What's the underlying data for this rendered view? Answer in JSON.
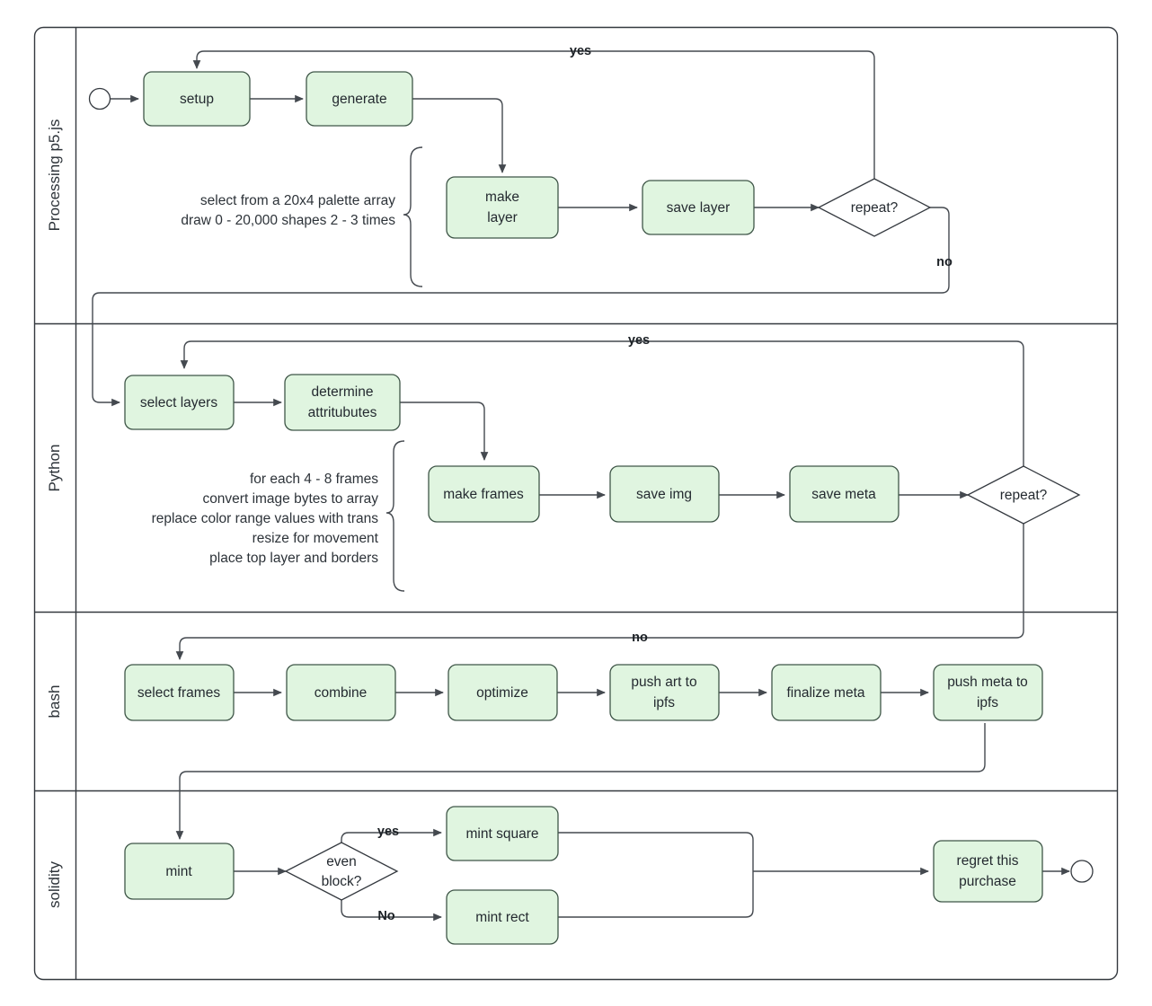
{
  "diagram": {
    "title": "Generative NFT pipeline swimlane flowchart",
    "colors": {
      "node_fill": "#e0f5e0",
      "node_stroke": "#3f5648",
      "line": "#44494f",
      "lane_border": "#34393f",
      "background": "#ffffff",
      "text": "#242a30"
    },
    "lanes": [
      {
        "id": "lane-processing",
        "label": "Processing p5.js"
      },
      {
        "id": "lane-python",
        "label": "Python"
      },
      {
        "id": "lane-bash",
        "label": "bash"
      },
      {
        "id": "lane-solidity",
        "label": "solidity"
      }
    ],
    "nodes": {
      "start": {
        "label": "",
        "shape": "start-circle"
      },
      "setup": {
        "label": "setup",
        "shape": "rounded-rect"
      },
      "generate": {
        "label": "generate",
        "shape": "rounded-rect"
      },
      "make_layer_1": {
        "label": "make",
        "shape": "rounded-rect"
      },
      "make_layer_2": {
        "label": "layer",
        "shape": "rounded-rect"
      },
      "save_layer": {
        "label": "save layer",
        "shape": "rounded-rect"
      },
      "repeat_p5": {
        "label": "repeat?",
        "shape": "diamond"
      },
      "select_layers": {
        "label": "select layers",
        "shape": "rounded-rect"
      },
      "determine_1": {
        "label": "determine",
        "shape": "rounded-rect"
      },
      "determine_2": {
        "label": "attritubutes",
        "shape": "rounded-rect"
      },
      "make_frames": {
        "label": "make frames",
        "shape": "rounded-rect"
      },
      "save_img": {
        "label": "save img",
        "shape": "rounded-rect"
      },
      "save_meta": {
        "label": "save meta",
        "shape": "rounded-rect"
      },
      "repeat_py": {
        "label": "repeat?",
        "shape": "diamond"
      },
      "select_frames": {
        "label": "select frames",
        "shape": "rounded-rect"
      },
      "combine": {
        "label": "combine",
        "shape": "rounded-rect"
      },
      "optimize": {
        "label": "optimize",
        "shape": "rounded-rect"
      },
      "push_art_1": {
        "label": "push art to",
        "shape": "rounded-rect"
      },
      "push_art_2": {
        "label": "ipfs",
        "shape": "rounded-rect"
      },
      "finalize_meta": {
        "label": "finalize meta",
        "shape": "rounded-rect"
      },
      "push_meta_1": {
        "label": "push meta to",
        "shape": "rounded-rect"
      },
      "push_meta_2": {
        "label": "ipfs",
        "shape": "rounded-rect"
      },
      "mint": {
        "label": "mint",
        "shape": "rounded-rect"
      },
      "even_block_1": {
        "label": "even",
        "shape": "diamond"
      },
      "even_block_2": {
        "label": "block?",
        "shape": "diamond"
      },
      "mint_square": {
        "label": "mint square",
        "shape": "rounded-rect"
      },
      "mint_rect": {
        "label": "mint rect",
        "shape": "rounded-rect"
      },
      "regret_1": {
        "label": "regret this",
        "shape": "rounded-rect"
      },
      "regret_2": {
        "label": "purchase",
        "shape": "rounded-rect"
      },
      "end": {
        "label": "",
        "shape": "end-circle"
      }
    },
    "edge_labels": {
      "p5_yes": "yes",
      "p5_no": "no",
      "py_yes": "yes",
      "bash_no": "no",
      "even_yes": "yes",
      "even_no": "No"
    },
    "annotations": {
      "p5": {
        "lines": [
          "select from a 20x4 palette array",
          "draw 0 - 20,000 shapes 2 - 3 times"
        ]
      },
      "python": {
        "lines": [
          "for each 4 - 8 frames",
          "convert image bytes to array",
          "replace color range values with trans",
          "resize for movement",
          "place top layer and borders"
        ]
      }
    }
  }
}
